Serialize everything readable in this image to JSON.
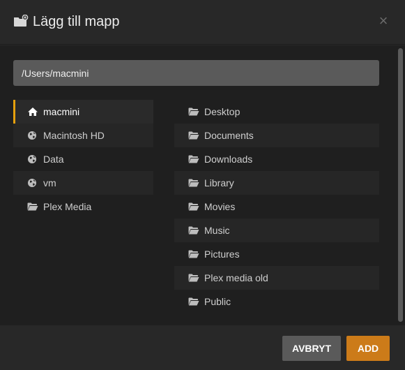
{
  "dialog": {
    "title": "Lägg till mapp",
    "close_label": "×"
  },
  "path": {
    "value": "/Users/macmini"
  },
  "locations": [
    {
      "label": "macmini",
      "icon": "home-icon"
    },
    {
      "label": "Macintosh HD",
      "icon": "globe-icon"
    },
    {
      "label": "Data",
      "icon": "globe-icon"
    },
    {
      "label": "vm",
      "icon": "globe-icon"
    },
    {
      "label": "Plex Media",
      "icon": "folder-icon"
    }
  ],
  "folders": [
    {
      "label": "Desktop",
      "icon": "folder-icon"
    },
    {
      "label": "Documents",
      "icon": "folder-icon"
    },
    {
      "label": "Downloads",
      "icon": "folder-icon"
    },
    {
      "label": "Library",
      "icon": "folder-icon"
    },
    {
      "label": "Movies",
      "icon": "folder-icon"
    },
    {
      "label": "Music",
      "icon": "folder-icon"
    },
    {
      "label": "Pictures",
      "icon": "folder-icon"
    },
    {
      "label": "Plex media old",
      "icon": "folder-icon"
    },
    {
      "label": "Public",
      "icon": "folder-icon"
    }
  ],
  "footer": {
    "cancel_label": "AVBRYT",
    "add_label": "ADD"
  },
  "colors": {
    "accent": "#e5a00d",
    "add_button": "#cc7b19",
    "cancel_button": "#5a5a5a"
  }
}
